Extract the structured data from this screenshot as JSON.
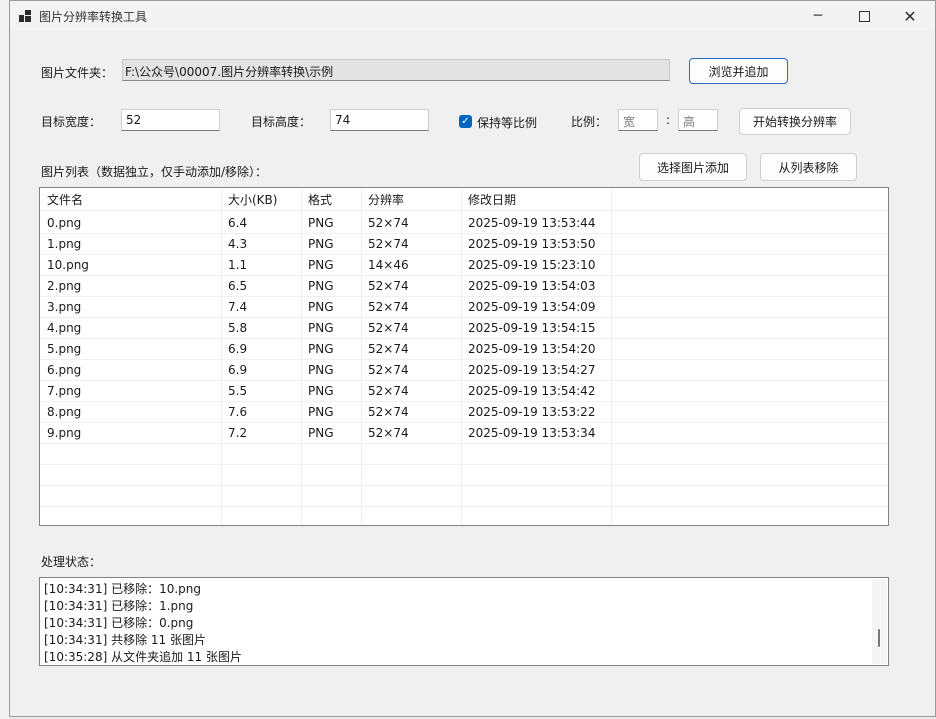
{
  "window": {
    "title": "图片分辨率转换工具"
  },
  "folder": {
    "label": "图片文件夹：",
    "path": "F:\\公众号\\00007.图片分辨率转换\\示例",
    "browse_label": "浏览并追加"
  },
  "target": {
    "width_label": "目标宽度：",
    "width_value": "52",
    "height_label": "目标高度：",
    "height_value": "74",
    "keep_ratio_label": "保持等比例",
    "keep_ratio_checked": true,
    "ratio_label": "比例：",
    "ratio_width_placeholder": "宽",
    "ratio_colon": ":",
    "ratio_height_placeholder": "高",
    "convert_label": "开始转换分辨率"
  },
  "list": {
    "label": "图片列表（数据独立，仅手动添加/移除）：",
    "add_label": "选择图片添加",
    "remove_label": "从列表移除",
    "columns": [
      "文件名",
      "大小(KB)",
      "格式",
      "分辨率",
      "修改日期"
    ],
    "rows": [
      [
        "0.png",
        "6.4",
        "PNG",
        "52×74",
        "2025-09-19 13:53:44"
      ],
      [
        "1.png",
        "4.3",
        "PNG",
        "52×74",
        "2025-09-19 13:53:50"
      ],
      [
        "10.png",
        "1.1",
        "PNG",
        "14×46",
        "2025-09-19 15:23:10"
      ],
      [
        "2.png",
        "6.5",
        "PNG",
        "52×74",
        "2025-09-19 13:54:03"
      ],
      [
        "3.png",
        "7.4",
        "PNG",
        "52×74",
        "2025-09-19 13:54:09"
      ],
      [
        "4.png",
        "5.8",
        "PNG",
        "52×74",
        "2025-09-19 13:54:15"
      ],
      [
        "5.png",
        "6.9",
        "PNG",
        "52×74",
        "2025-09-19 13:54:20"
      ],
      [
        "6.png",
        "6.9",
        "PNG",
        "52×74",
        "2025-09-19 13:54:27"
      ],
      [
        "7.png",
        "5.5",
        "PNG",
        "52×74",
        "2025-09-19 13:54:42"
      ],
      [
        "8.png",
        "7.6",
        "PNG",
        "52×74",
        "2025-09-19 13:53:22"
      ],
      [
        "9.png",
        "7.2",
        "PNG",
        "52×74",
        "2025-09-19 13:53:34"
      ]
    ]
  },
  "status": {
    "label": "处理状态：",
    "lines": [
      "[10:34:31] 已移除：10.png",
      "[10:34:31] 已移除：1.png",
      "[10:34:31] 已移除：0.png",
      "[10:34:31] 共移除 11 张图片",
      "[10:35:28] 从文件夹追加 11 张图片"
    ]
  },
  "colors": {
    "accent": "#0067c0",
    "primary_border": "#2a6bc4"
  }
}
